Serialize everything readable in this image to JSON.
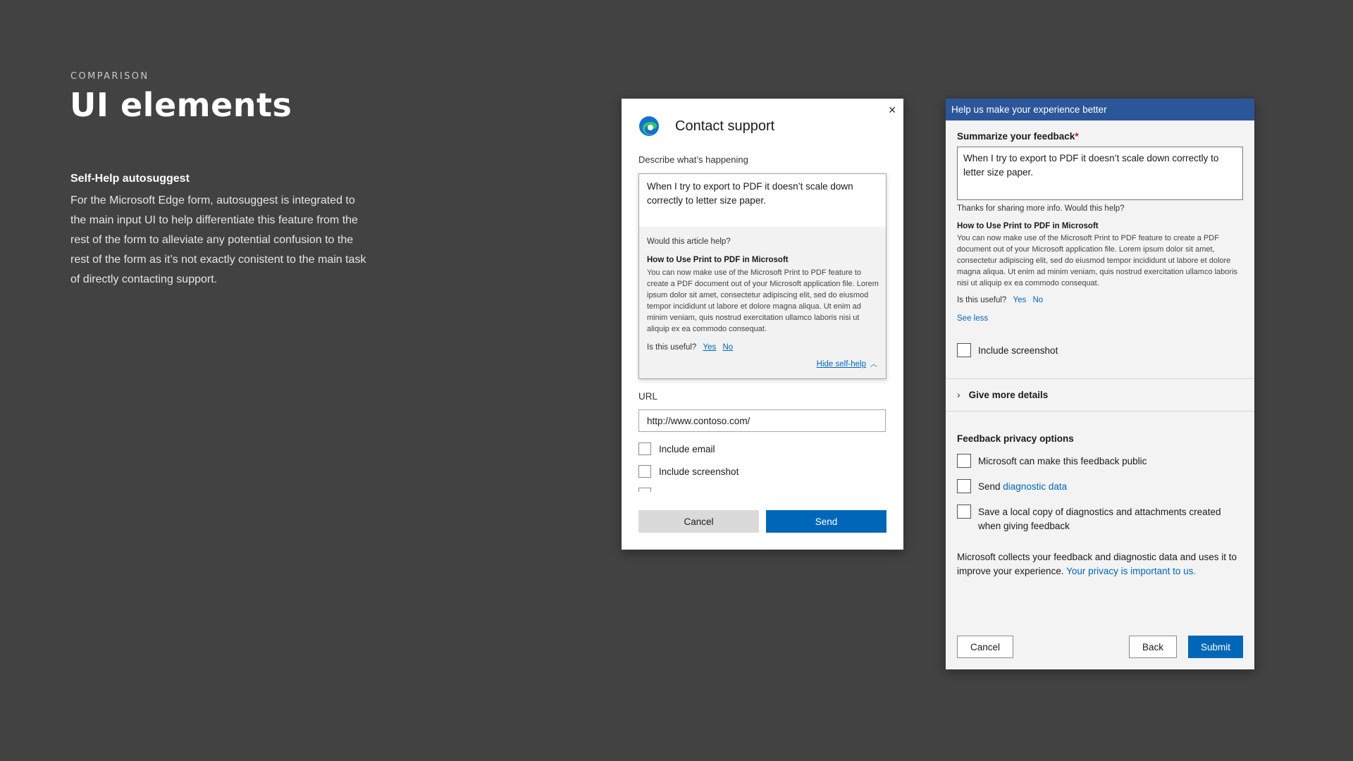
{
  "intro": {
    "eyebrow": "COMPARISON",
    "title": "UI elements",
    "section_title": "Self-Help autosuggest",
    "section_body": "For the Microsoft Edge form, autosuggest is integrated to the main input UI to help differentiate this feature from the rest of the form to alleviate any potential confusion to the rest of the form as it’s not exactly conistent to the main task of directly contacting support."
  },
  "contact_dialog": {
    "title": "Contact support",
    "close_glyph": "✕",
    "describe_label": "Describe what’s happening",
    "describe_value": "When I try to export to PDF it doesn’t scale down correctly to letter size paper.",
    "selfhelp": {
      "question": "Would this article help?",
      "article_title": "How to Use Print to PDF in Microsoft",
      "article_body": "You can now make use of the Microsoft Print to PDF feature to create a PDF document out of your Microsoft application file. Lorem ipsum dolor sit amet, consectetur adipiscing elit, sed do eiusmod tempor incididunt ut labore et dolore magna aliqua. Ut enim ad minim veniam, quis nostrud exercitation ullamco laboris nisi ut aliquip ex ea commodo consequat.",
      "useful_label": "Is this useful?",
      "yes": "Yes",
      "no": "No",
      "hide_label": "Hide self-help"
    },
    "url_label": "URL",
    "url_value": "http://www.contoso.com/",
    "checkboxes": [
      "Include email",
      "Include screenshot"
    ],
    "cancel": "Cancel",
    "send": "Send"
  },
  "feedback_dialog": {
    "header": "Help us make your experience better",
    "summarize_label": "Summarize your feedback",
    "required_mark": "*",
    "summary_value": "When I try to export to PDF it doesn’t scale down correctly to letter size paper.",
    "thanks": "Thanks for sharing more info. Would this help?",
    "article_title": "How to Use Print to PDF in Microsoft",
    "article_body": "You can now make use of the Microsoft Print to PDF feature to create a PDF document out of your Microsoft application file. Lorem ipsum dolor sit amet, consectetur adipiscing elit, sed do eiusmod tempor incididunt ut labore et dolore magna aliqua. Ut enim ad minim veniam, quis nostrud exercitation ullamco laboris nisi ut aliquip ex ea commodo consequat.",
    "useful_label": "Is this useful?",
    "yes": "Yes",
    "no": "No",
    "see_less": "See less",
    "include_screenshot": "Include screenshot",
    "give_more": "Give more details",
    "privacy_title": "Feedback privacy options",
    "opt_public": "Microsoft can make this feedback public",
    "opt_send_prefix": "Send",
    "opt_send_link": "diagnostic data",
    "opt_save": "Save a local copy of diagnostics and attachments created when giving feedback",
    "notice_text": "Microsoft collects your feedback and diagnostic data and uses it to improve your experience.",
    "notice_link": "Your privacy is important to us.",
    "cancel": "Cancel",
    "back": "Back",
    "submit": "Submit"
  },
  "colors": {
    "background": "#424242",
    "accent_blue": "#0067b8",
    "header_blue": "#2b579a",
    "required_red": "#c50f1f"
  },
  "icons": [
    "edge-logo-icon",
    "close-icon",
    "chevron-up-icon",
    "chevron-right-icon"
  ]
}
